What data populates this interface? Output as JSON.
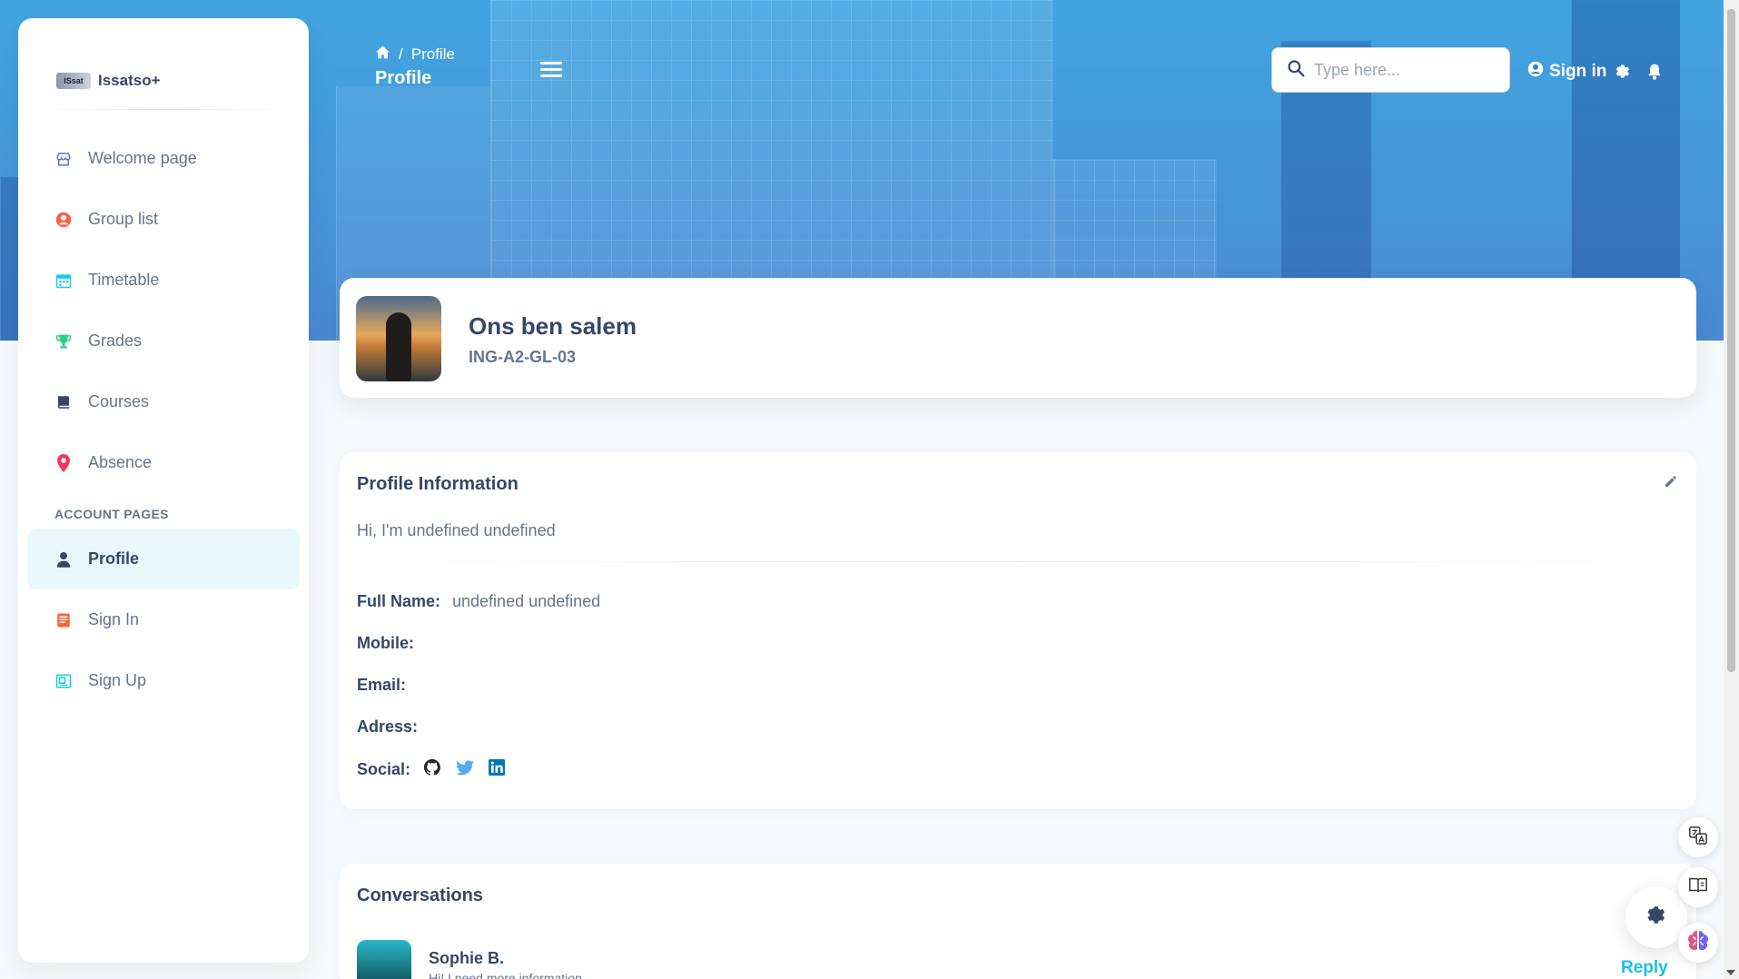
{
  "brand": {
    "logo_text": "ISsat",
    "name": "Issatso+"
  },
  "sidebar": {
    "items": [
      {
        "label": "Welcome page",
        "icon": "shop-icon",
        "color": "#5e72e4"
      },
      {
        "label": "Group list",
        "icon": "user-circle-icon",
        "color": "#fb6340"
      },
      {
        "label": "Timetable",
        "icon": "calendar-icon",
        "color": "#11cdef"
      },
      {
        "label": "Grades",
        "icon": "trophy-icon",
        "color": "#2dce89"
      },
      {
        "label": "Courses",
        "icon": "book-icon",
        "color": "#344767"
      },
      {
        "label": "Absence",
        "icon": "map-pin-icon",
        "color": "#f5365c"
      }
    ],
    "section_title": "ACCOUNT PAGES",
    "account_items": [
      {
        "label": "Profile",
        "icon": "person-icon",
        "active": true
      },
      {
        "label": "Sign In",
        "icon": "document-icon",
        "color": "#fb6340"
      },
      {
        "label": "Sign Up",
        "icon": "id-card-icon",
        "color": "#11cdef"
      }
    ]
  },
  "header": {
    "breadcrumb": "Profile",
    "title": "Profile",
    "search_placeholder": "Type here...",
    "signin_label": "Sign in"
  },
  "profile": {
    "name": "Ons ben salem",
    "group": "ING-A2-GL-03"
  },
  "info": {
    "title": "Profile Information",
    "bio": "Hi, I'm undefined undefined",
    "full_name_label": "Full Name:",
    "full_name_value": "undefined undefined",
    "mobile_label": "Mobile:",
    "email_label": "Email:",
    "address_label": "Adress:",
    "social_label": "Social:",
    "social": [
      "github-icon",
      "twitter-icon",
      "linkedin-icon"
    ]
  },
  "conversations": {
    "title": "Conversations",
    "items": [
      {
        "name": "Sophie B.",
        "message": "Hi! I need more information...",
        "action": "Reply"
      }
    ]
  },
  "colors": {
    "accent": "#17c1e8",
    "text": "#344767",
    "muted": "#67748e"
  }
}
